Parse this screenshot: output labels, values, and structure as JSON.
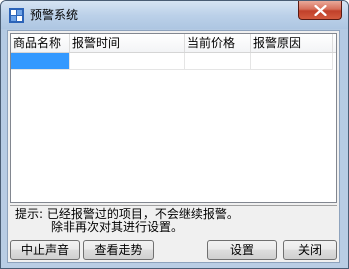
{
  "window": {
    "title": "预警系统"
  },
  "list": {
    "columns": [
      "商品名称",
      "报警时间",
      "当前价格",
      "报警原因"
    ]
  },
  "hint": {
    "line1": "提示: 已经报警过的项目，不会继续报警。",
    "line2": "除非再次对其进行设置。"
  },
  "buttons": {
    "stop_sound": "中止声音",
    "view_trend": "查看走势",
    "settings": "设置",
    "close": "关闭"
  },
  "colors": {
    "selection": "#3399ff",
    "close_button": "#c1402a"
  },
  "icons": {
    "app": "app-icon",
    "close": "close-icon"
  }
}
